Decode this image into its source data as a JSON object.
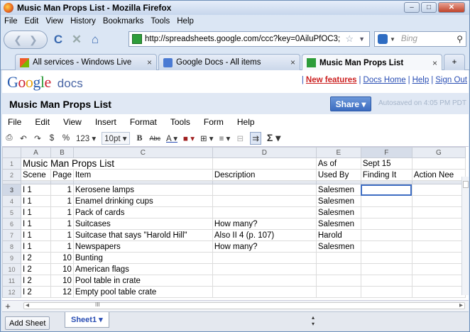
{
  "window": {
    "title": "Music Man Props List - Mozilla Firefox",
    "minimize": "–",
    "maximize": "□",
    "close": "✕"
  },
  "menubar": [
    "File",
    "Edit",
    "View",
    "History",
    "Bookmarks",
    "Tools",
    "Help"
  ],
  "nav": {
    "back": "❮",
    "forward": "❯",
    "reload": "C",
    "stop": "✕",
    "home": "⌂",
    "url": "http://spreadsheets.google.com/ccc?key=0AiluPfOC3;",
    "search_engine": "b·",
    "search_placeholder": "Bing"
  },
  "tabs": [
    {
      "label": "All services - Windows Live",
      "close": "×"
    },
    {
      "label": "Google Docs - All items",
      "close": "×"
    },
    {
      "label": "Music Man Props List",
      "close": "×"
    }
  ],
  "tab_new": "+",
  "google": {
    "logo": "Google",
    "logo_suffix": "docs",
    "new_features": "New features",
    "links": [
      "Docs Home",
      "Help",
      "Sign Out"
    ]
  },
  "doc": {
    "title": "Music Man Props List",
    "share": "Share ▾",
    "autosave": "Autosaved on 4:05 PM PDT"
  },
  "sheet_menu": [
    "File",
    "Edit",
    "View",
    "Insert",
    "Format",
    "Tools",
    "Form",
    "Help"
  ],
  "toolbar": {
    "currency": "$",
    "percent": "%",
    "number_format": "123 ▾",
    "font_size": "10pt ▾",
    "bold": "B",
    "strike": "Abc",
    "text_color": "A ▾",
    "bg_color": "■ ▾",
    "borders": "⊞ ▾",
    "align": "≡ ▾",
    "merge": "⊟",
    "wrap": "⇉",
    "sum": "Σ ▾"
  },
  "columns": [
    "A",
    "B",
    "C",
    "D",
    "E",
    "F",
    "G"
  ],
  "rows": [
    {
      "n": "1",
      "cells": [
        "Music Man Props List",
        "",
        "",
        "",
        "As of",
        "Sept 15",
        ""
      ]
    },
    {
      "n": "2",
      "cells": [
        "Scene",
        "Page",
        "Item",
        "Description",
        "Used By",
        "Finding It",
        "Action Nee"
      ]
    },
    {
      "n": "3",
      "cells": [
        "I 1",
        "1",
        "Kerosene lamps",
        "",
        "Salesmen",
        "",
        ""
      ]
    },
    {
      "n": "4",
      "cells": [
        "I 1",
        "1",
        "Enamel drinking cups",
        "",
        "Salesmen",
        "",
        ""
      ]
    },
    {
      "n": "5",
      "cells": [
        "I 1",
        "1",
        "Pack of cards",
        "",
        "Salesmen",
        "",
        ""
      ]
    },
    {
      "n": "6",
      "cells": [
        "I 1",
        "1",
        "Suitcases",
        "How many?",
        "Salesmen",
        "",
        ""
      ]
    },
    {
      "n": "7",
      "cells": [
        "I 1",
        "1",
        "Suitcase that says \"Harold Hill\"",
        "Also II 4 (p. 107)",
        "Harold",
        "",
        ""
      ]
    },
    {
      "n": "8",
      "cells": [
        "I 1",
        "1",
        "Newspapers",
        "How many?",
        "Salesmen",
        "",
        ""
      ]
    },
    {
      "n": "9",
      "cells": [
        "I 2",
        "10",
        "Bunting",
        "",
        "",
        "",
        ""
      ]
    },
    {
      "n": "10",
      "cells": [
        "I 2",
        "10",
        "American flags",
        "",
        "",
        "",
        ""
      ]
    },
    {
      "n": "11",
      "cells": [
        "I 2",
        "10",
        "Pool table in crate",
        "",
        "",
        "",
        ""
      ]
    },
    {
      "n": "12",
      "cells": [
        "I 2",
        "12",
        "Empty pool table crate",
        "",
        "",
        "",
        ""
      ]
    }
  ],
  "bottom": {
    "add": "+",
    "scroll_left": "◂",
    "scroll_right": "▸",
    "grip": "III"
  },
  "sheetbar": {
    "add_sheet": "Add Sheet",
    "sheet_tab": "Sheet1 ▾"
  }
}
